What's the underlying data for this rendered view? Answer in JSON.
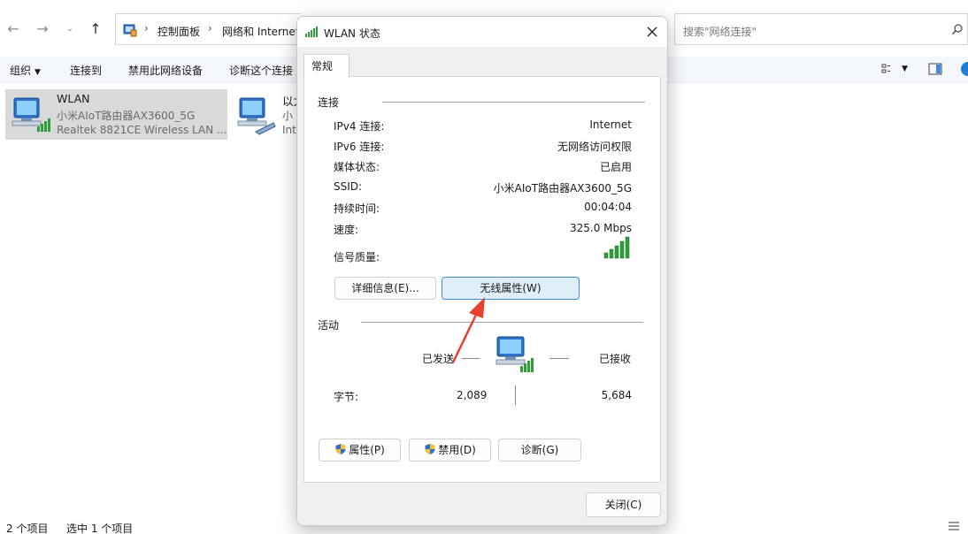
{
  "explorer": {
    "breadcrumb": [
      "控制面板",
      "网络和 Internet"
    ],
    "search_placeholder": "搜索\"网络连接\"",
    "commands": {
      "organize": "组织",
      "connect_to": "连接到",
      "disable_device": "禁用此网络设备",
      "diagnose": "诊断这个连接"
    },
    "items": [
      {
        "name": "WLAN",
        "line1": "小米AIoT路由器AX3600_5G",
        "line2": "Realtek 8821CE Wireless LAN ..."
      },
      {
        "name": "以太",
        "line1": "小",
        "line2": "Int"
      }
    ],
    "status": {
      "item_count": "2 个项目",
      "selected_count": "选中 1 个项目"
    }
  },
  "dialog": {
    "title": "WLAN 状态",
    "tab": "常规",
    "connection": {
      "heading": "连接",
      "rows": [
        {
          "label": "IPv4 连接:",
          "value": "Internet"
        },
        {
          "label": "IPv6 连接:",
          "value": "无网络访问权限"
        },
        {
          "label": "媒体状态:",
          "value": "已启用"
        },
        {
          "label": "SSID:",
          "value": "小米AIoT路由器AX3600_5G"
        },
        {
          "label": "持续时间:",
          "value": "00:04:04"
        },
        {
          "label": "速度:",
          "value": "325.0 Mbps"
        }
      ],
      "signal_label": "信号质量:",
      "details_button": "详细信息(E)...",
      "wireless_button": "无线属性(W)"
    },
    "activity": {
      "heading": "活动",
      "sent_label": "已发送",
      "received_label": "已接收",
      "bytes_label": "字节:",
      "bytes_sent": "2,089",
      "bytes_received": "5,684"
    },
    "buttons": {
      "properties": "属性(P)",
      "disable": "禁用(D)",
      "diagnose": "诊断(G)",
      "close": "关闭(C)"
    }
  },
  "colors": {
    "accent": "#3d8ee0",
    "signal_green": "#2e9e3a",
    "annotation_arrow": "#e8402f"
  }
}
